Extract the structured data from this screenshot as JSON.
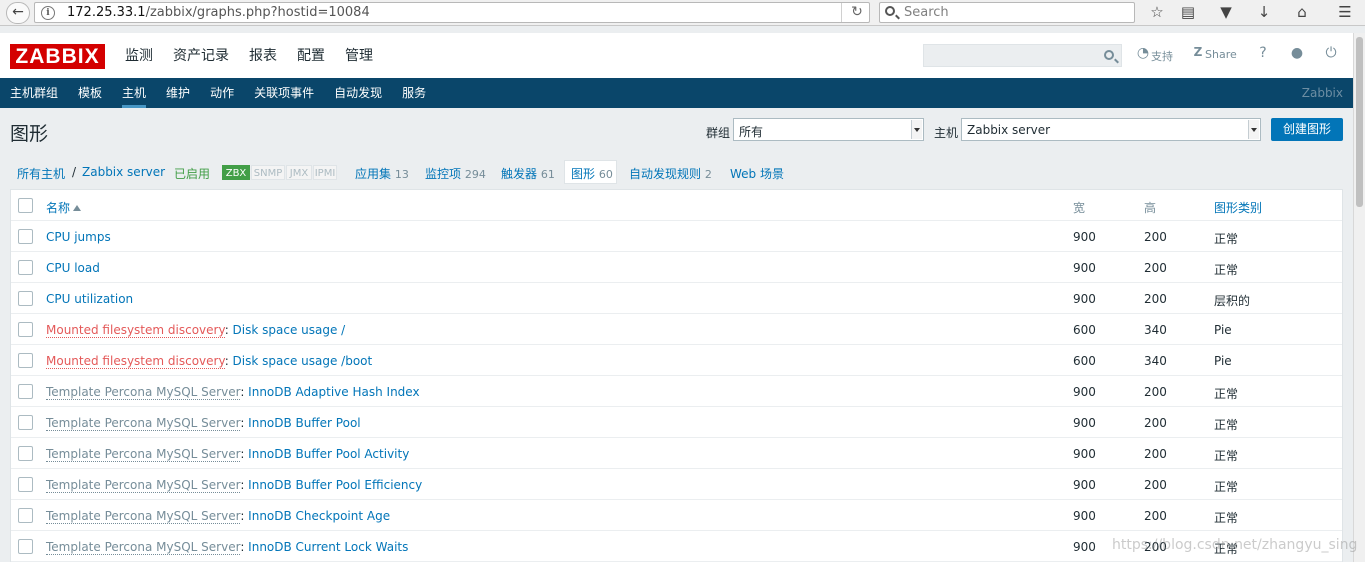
{
  "browser": {
    "url_host": "172.25.33.1",
    "url_path": "/zabbix/graphs.php?hostid=10084",
    "search_placeholder": "Search"
  },
  "header": {
    "logo": "ZABBIX",
    "menu": [
      "监测",
      "资产记录",
      "报表",
      "配置",
      "管理"
    ],
    "active_menu": "配置",
    "support_label": "支持",
    "share_label": "Share",
    "help_label": "?"
  },
  "submenu": {
    "items": [
      "主机群组",
      "模板",
      "主机",
      "维护",
      "动作",
      "关联项事件",
      "自动发现",
      "服务"
    ],
    "active": "主机",
    "server_name": "Zabbix"
  },
  "page": {
    "title": "图形",
    "group_label": "群组",
    "group_value": "所有",
    "host_label": "主机",
    "host_value": "Zabbix server",
    "create_button": "创建图形"
  },
  "host_nav": {
    "all_hosts": "所有主机",
    "separator": "/",
    "host": "Zabbix server",
    "status": "已启用",
    "availability": [
      "ZBX",
      "SNMP",
      "JMX",
      "IPMI"
    ],
    "apps_label": "应用集",
    "apps_count": "13",
    "items_label": "监控项",
    "items_count": "294",
    "triggers_label": "触发器",
    "triggers_count": "61",
    "graphs_label": "图形",
    "graphs_count": "60",
    "discovery_label": "自动发现规则",
    "discovery_count": "2",
    "web_label": "Web 场景"
  },
  "table": {
    "headers": {
      "name": "名称",
      "width": "宽",
      "height": "高",
      "type": "图形类别"
    },
    "rows": [
      {
        "prefix": "",
        "name": "CPU jumps",
        "width": "900",
        "height": "200",
        "type": "正常"
      },
      {
        "prefix": "",
        "name": "CPU load",
        "width": "900",
        "height": "200",
        "type": "正常"
      },
      {
        "prefix": "",
        "name": "CPU utilization",
        "width": "900",
        "height": "200",
        "type": "层积的"
      },
      {
        "prefix": "Mounted filesystem discovery",
        "prefix_kind": "orange",
        "name": "Disk space usage /",
        "width": "600",
        "height": "340",
        "type": "Pie"
      },
      {
        "prefix": "Mounted filesystem discovery",
        "prefix_kind": "orange",
        "name": "Disk space usage /boot",
        "width": "600",
        "height": "340",
        "type": "Pie"
      },
      {
        "prefix": "Template Percona MySQL Server",
        "prefix_kind": "gray",
        "name": "InnoDB Adaptive Hash Index",
        "width": "900",
        "height": "200",
        "type": "正常"
      },
      {
        "prefix": "Template Percona MySQL Server",
        "prefix_kind": "gray",
        "name": "InnoDB Buffer Pool",
        "width": "900",
        "height": "200",
        "type": "正常"
      },
      {
        "prefix": "Template Percona MySQL Server",
        "prefix_kind": "gray",
        "name": "InnoDB Buffer Pool Activity",
        "width": "900",
        "height": "200",
        "type": "正常"
      },
      {
        "prefix": "Template Percona MySQL Server",
        "prefix_kind": "gray",
        "name": "InnoDB Buffer Pool Efficiency",
        "width": "900",
        "height": "200",
        "type": "正常"
      },
      {
        "prefix": "Template Percona MySQL Server",
        "prefix_kind": "gray",
        "name": "InnoDB Checkpoint Age",
        "width": "900",
        "height": "200",
        "type": "正常"
      },
      {
        "prefix": "Template Percona MySQL Server",
        "prefix_kind": "gray",
        "name": "InnoDB Current Lock Waits",
        "width": "900",
        "height": "200",
        "type": "正常"
      }
    ]
  },
  "watermark": "https://blog.csdn.net/zhangyu_sing",
  "colors": {
    "brand": "#d40000",
    "nav": "#0a466a",
    "link": "#0275b8",
    "enabled": "#429e47",
    "discovery": "#e45959"
  }
}
